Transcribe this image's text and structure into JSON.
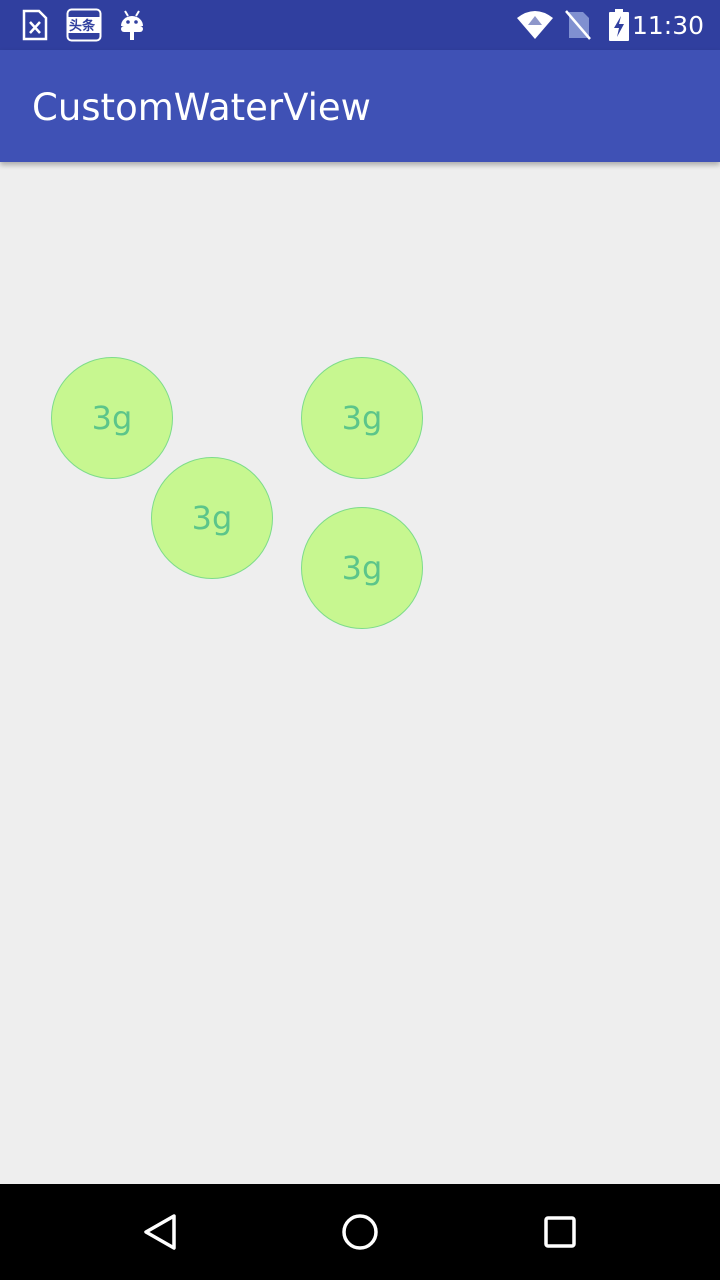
{
  "status_bar": {
    "time": "11:30",
    "left_icons": [
      "sim-card-error-icon",
      "toutiao-app-icon",
      "android-debug-icon"
    ],
    "right_icons": [
      "wifi-icon",
      "no-sim-icon",
      "battery-charging-icon"
    ],
    "toutiao_label": "头条"
  },
  "app_bar": {
    "title": "CustomWaterView",
    "color": "#3f51b5"
  },
  "content": {
    "bubbles": [
      {
        "label": "3g"
      },
      {
        "label": "3g"
      },
      {
        "label": "3g"
      },
      {
        "label": "3g"
      }
    ],
    "bubble_fill": "#c7f790",
    "bubble_text_color": "#5cc58a"
  },
  "nav_bar": {
    "buttons": [
      "back-icon",
      "home-icon",
      "recents-icon"
    ]
  }
}
